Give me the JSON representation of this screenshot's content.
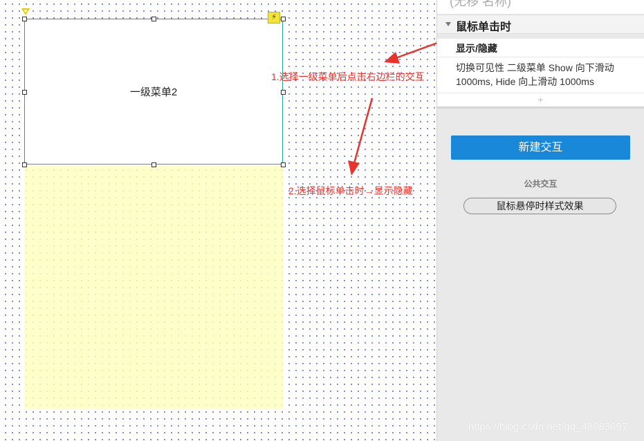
{
  "canvas": {
    "menu_box_label": "一级菜单2"
  },
  "annotations": {
    "step1": "1.选择一级菜单后点击右边栏的交互",
    "step2": "2.选择鼠标单击时→显示隐藏"
  },
  "panel": {
    "cut_header_text": "(无移 名称)",
    "event_title": "鼠标单击时",
    "action_label": "显示/隐藏",
    "action_detail": "切换可见性 二级菜单 Show 向下滑动 1000ms, Hide 向上滑动 1000ms",
    "add_symbol": "+",
    "new_interaction_label": "新建交互",
    "section_label": "公共交互",
    "hover_style_label": "鼠标悬停时样式效果"
  },
  "watermark": "https://blog.csdn.net/qq_48983697",
  "colors": {
    "annotation_red": "#e8332c",
    "selection_teal": "#1aa89a",
    "primary_blue": "#1a88d8",
    "dynamic_panel_yellow": "#ffffbe"
  },
  "icons": [
    "flag-icon",
    "lightning-icon",
    "caret-down-icon",
    "plus-icon"
  ]
}
